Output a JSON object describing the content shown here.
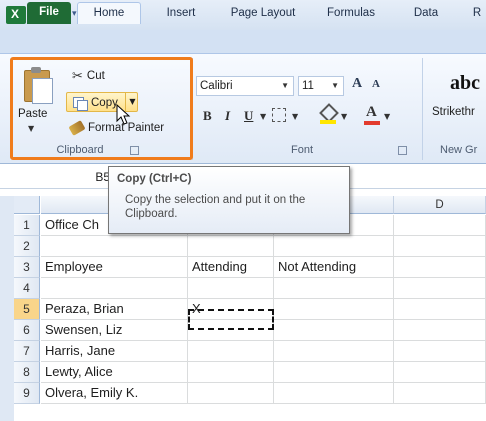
{
  "qat": {
    "undo_glyph": "↶",
    "redo_glyph": "↷",
    "dropdown_glyph": "▾"
  },
  "tabs": [
    "File",
    "Home",
    "Insert",
    "Page Layout",
    "Formulas",
    "Data",
    "R"
  ],
  "clipboard": {
    "paste_label": "Paste",
    "cut_label": "Cut",
    "copy_label": "Copy",
    "format_painter_label": "Format Painter",
    "group_label": "Clipboard"
  },
  "font": {
    "name": "Calibri",
    "size": "11",
    "grow": "A",
    "shrink": "A",
    "bold": "B",
    "italic": "I",
    "underline": "U",
    "color_glyph": "A",
    "group_label": "Font"
  },
  "styles": {
    "sample": "abc",
    "strikethrough_label": "Strikethr",
    "group_label": "New Gr"
  },
  "namebox": "B5",
  "tooltip": {
    "title": "Copy (Ctrl+C)",
    "body": "Copy the selection and put it on the Clipboard."
  },
  "columns": [
    "D"
  ],
  "rows": [
    {
      "num": "1",
      "a": "Office Ch",
      "b": "",
      "c": ""
    },
    {
      "num": "2",
      "a": "",
      "b": "",
      "c": ""
    },
    {
      "num": "3",
      "a": "Employee",
      "b": "Attending",
      "c": "Not Attending"
    },
    {
      "num": "4",
      "a": "",
      "b": "",
      "c": ""
    },
    {
      "num": "5",
      "a": "Peraza, Brian",
      "b": "X",
      "c": ""
    },
    {
      "num": "6",
      "a": "Swensen, Liz",
      "b": "",
      "c": ""
    },
    {
      "num": "7",
      "a": "Harris, Jane",
      "b": "",
      "c": ""
    },
    {
      "num": "8",
      "a": "Lewty, Alice",
      "b": "",
      "c": ""
    },
    {
      "num": "9",
      "a": "Olvera, Emily K.",
      "b": "",
      "c": ""
    }
  ],
  "colors": {
    "highlight": "#f07c1b",
    "file_tab": "#1f6b35",
    "selected_row": "#f9d58a"
  }
}
